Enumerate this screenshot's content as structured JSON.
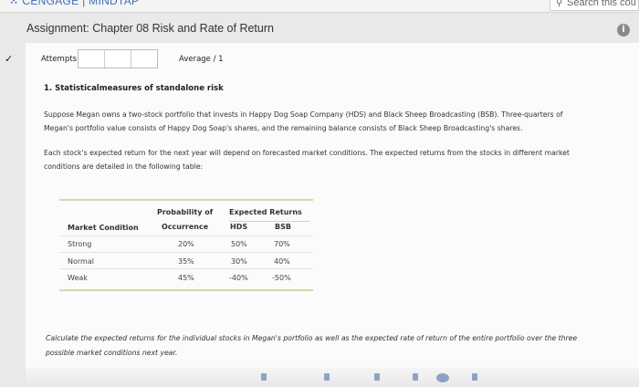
{
  "topbar": {
    "brand": "CENGAGE | MINDTAP",
    "search_placeholder": "Search this cou"
  },
  "header": {
    "title": "Assignment: Chapter 08 Risk and Rate of Return",
    "info_icon_label": "i"
  },
  "attempts": {
    "label": "Attempts",
    "average_label": "Average / 1"
  },
  "question": {
    "title": "1. Statisticalmeasures of standalone risk",
    "paragraph1_line1": "Suppose Megan owns a two-stock portfolio that invests in Happy Dog Soap Company (HDS) and Black Sheep Broadcasting (BSB). Three-quarters of",
    "paragraph1_line2": "Megan's portfolio value consists of Happy Dog Soap's shares, and the remaining balance consists of Black Sheep Broadcasting's shares.",
    "paragraph2_line1": "Each stock's expected return for the next year will depend on forecasted market conditions. The expected returns from the stocks in different market",
    "paragraph2_line2": "conditions are detailed in the following table:",
    "prompt_line1": "Calculate the expected returns for the individual stocks in Megan's portfolio as well as the expected rate of return of the entire portfolio over the three",
    "prompt_line2": "possible market conditions next year."
  },
  "table": {
    "headers": {
      "prob_line1": "Probability of",
      "prob_line2": "Occurrence",
      "expected_returns": "Expected Returns",
      "market_condition": "Market Condition",
      "hds": "HDS",
      "bsb": "BSB"
    },
    "rows": [
      {
        "condition": "Strong",
        "probability": "20%",
        "hds": "50%",
        "bsb": "70%"
      },
      {
        "condition": "Normal",
        "probability": "35%",
        "hds": "30%",
        "bsb": "40%"
      },
      {
        "condition": "Weak",
        "probability": "45%",
        "hds": "-40%",
        "bsb": "-50%"
      }
    ]
  },
  "colors": {
    "accent": "#3b6fb6",
    "table_rule": "#d6d8a8",
    "background": "#e9e9ea"
  }
}
